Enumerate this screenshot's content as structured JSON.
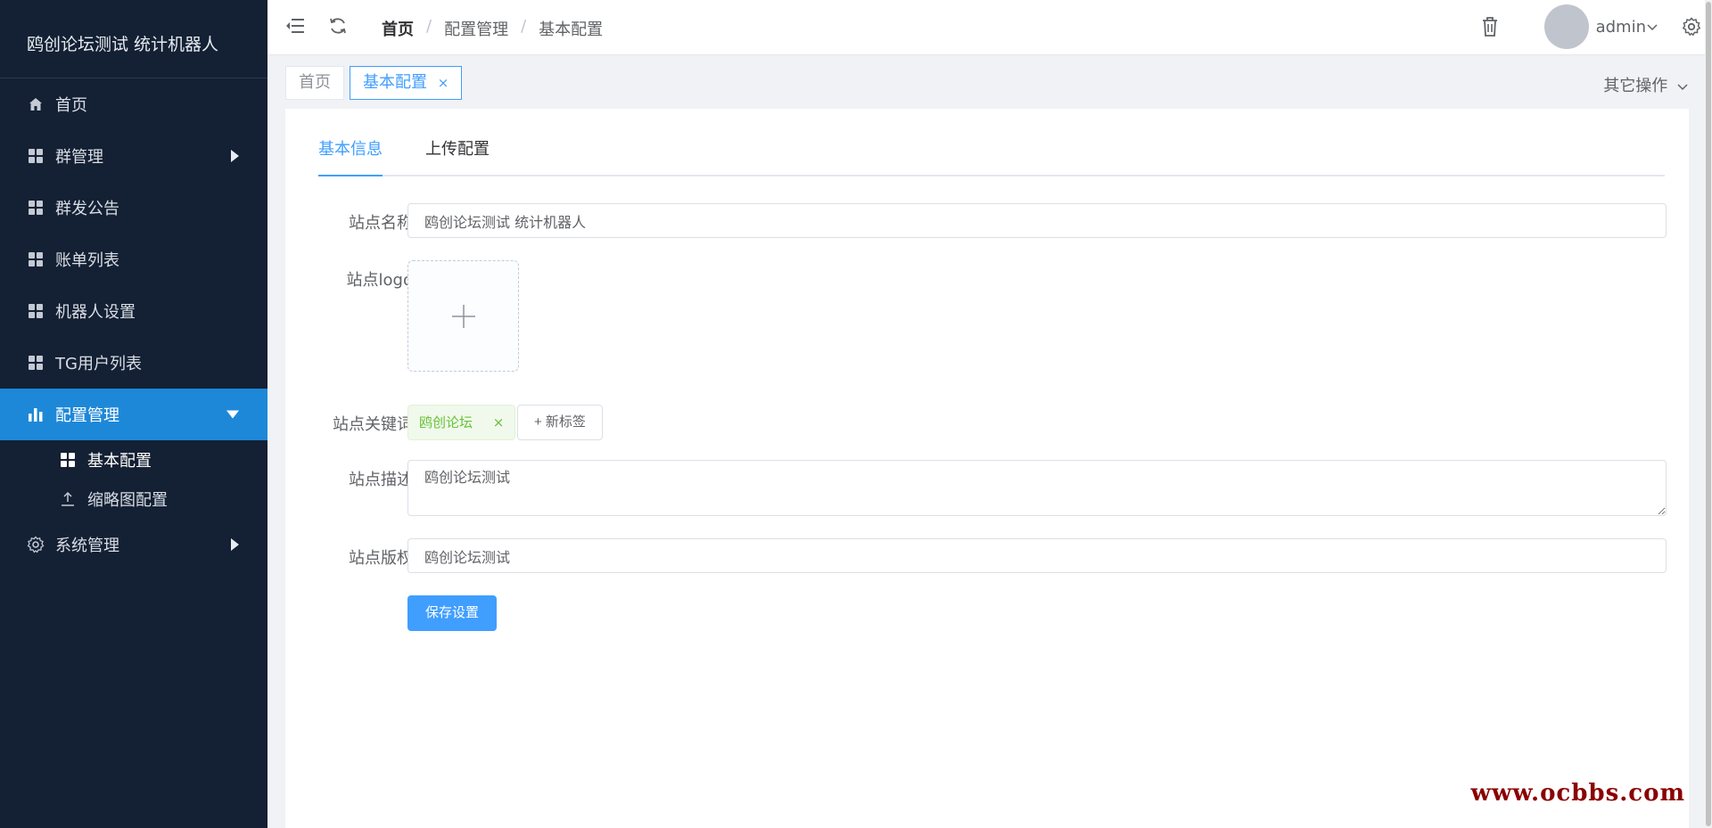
{
  "sidebar": {
    "brand": "鸥创论坛测试 统计机器人",
    "items": [
      {
        "label": "首页"
      },
      {
        "label": "群管理"
      },
      {
        "label": "群发公告"
      },
      {
        "label": "账单列表"
      },
      {
        "label": "机器人设置"
      },
      {
        "label": "TG用户列表"
      },
      {
        "label": "配置管理"
      },
      {
        "label": "系统管理"
      }
    ],
    "submenu": [
      {
        "label": "基本配置"
      },
      {
        "label": "缩略图配置"
      }
    ]
  },
  "header": {
    "breadcrumb": [
      "首页",
      "配置管理",
      "基本配置"
    ],
    "separator": "/",
    "username": "admin"
  },
  "tagsbar": {
    "tabs": [
      {
        "label": "首页"
      },
      {
        "label": "基本配置",
        "close": "×"
      }
    ],
    "other_ops": "其它操作"
  },
  "main": {
    "tabs": [
      {
        "label": "基本信息"
      },
      {
        "label": "上传配置"
      }
    ],
    "form": {
      "site_name_label": "站点名称",
      "site_name_value": "鸥创论坛测试 统计机器人",
      "site_logo_label": "站点logo",
      "keywords_label": "站点关键词",
      "keywords": [
        "鸥创论坛"
      ],
      "keyword_close": "×",
      "new_tag_label": "+ 新标签",
      "description_label": "站点描述",
      "description_value": "鸥创论坛测试",
      "copyright_label": "站点版权",
      "copyright_value": "鸥创论坛测试",
      "save_label": "保存设置"
    }
  },
  "watermark": "www.ocbbs.com",
  "colors": {
    "sidebar_bg": "#142033",
    "accent": "#409eff",
    "active_menu": "#1e88d8"
  }
}
